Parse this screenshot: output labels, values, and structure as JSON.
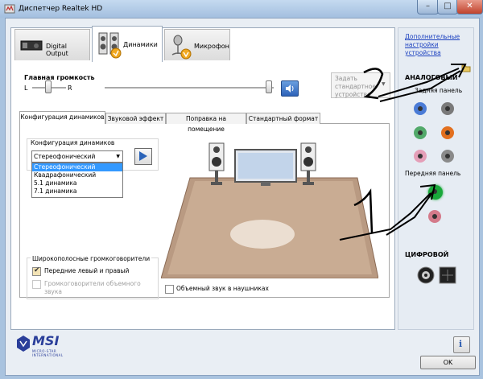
{
  "window": {
    "title": "Диспетчер Realtek HD",
    "minimize": "–",
    "maximize": "□",
    "close": "✕"
  },
  "device_tabs": [
    {
      "label": "Digital Output",
      "icon": "digital-output-icon"
    },
    {
      "label": "Динамики",
      "icon": "speakers-icon"
    },
    {
      "label": "Микрофон",
      "icon": "microphone-icon"
    }
  ],
  "volume": {
    "title": "Главная громкость",
    "left": "L",
    "right": "R",
    "balance_level": 0.5,
    "volume_level": 0.95,
    "default_device": "Задать стандартное устройство"
  },
  "inner_tabs": [
    "Конфигурация динамиков",
    "Звуковой эффект",
    "Поправка на помещение",
    "Стандартный формат"
  ],
  "speaker_config": {
    "label": "Конфигурация динамиков",
    "selected": "Стереофонический",
    "options": [
      "Стереофонический",
      "Квадрафонический",
      "5.1 динамика",
      "7.1 динамика"
    ],
    "highlighted_index": 0
  },
  "wideband": {
    "title": "Широкополосные громкоговорители",
    "front": "Передние левый и правый",
    "front_checked": true,
    "surround": "Громкоговорители объемного звука",
    "surround_checked": false,
    "surround_enabled": false
  },
  "headphones": {
    "label": "Объемный звук в наушниках",
    "checked": false
  },
  "right_panel": {
    "advanced_link": "Дополнительные настройки устройства",
    "analog_title": "АНАЛОГОВЫЙ",
    "rear_label": "Задняя панель",
    "front_label": "Передняя панель",
    "digital_title": "ЦИФРОВОЙ",
    "rear_jacks": [
      "#4a7bd6",
      "#7a7a7a",
      "#52a96a",
      "#e2701f",
      "#e59fb8",
      "#8a8a8a"
    ],
    "front_jacks": [
      "#19a83a",
      "#d47a8a"
    ]
  },
  "annotations": [
    "2",
    "1"
  ],
  "footer": {
    "logo": "MSI",
    "logo_sub": "MICRO-STAR INTERNATIONAL",
    "info": "i",
    "ok": "OK"
  }
}
